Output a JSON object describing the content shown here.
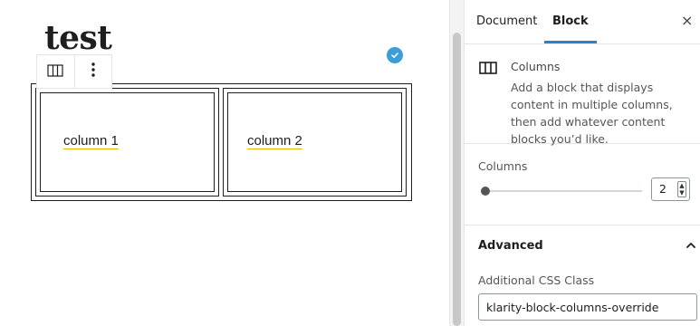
{
  "editor": {
    "post_title": "test",
    "columns": [
      {
        "text": "column 1"
      },
      {
        "text": "column 2"
      }
    ]
  },
  "sidebar": {
    "tabs": [
      {
        "label": "Document",
        "active": false
      },
      {
        "label": "Block",
        "active": true
      }
    ],
    "close_label": "×",
    "block_card": {
      "title": "Columns",
      "description": "Add a block that displays content in multiple columns, then add whatever content blocks you’d like."
    },
    "columns_panel": {
      "label": "Columns",
      "value": "2",
      "range_value": 2
    },
    "advanced_panel": {
      "title": "Advanced",
      "css_class_label": "Additional CSS Class",
      "css_class_value": "klarity-block-columns-override"
    }
  },
  "colors": {
    "accent": "#2f81c4",
    "saved_badge": "#3d9dd9",
    "underline": "#e4b700"
  },
  "icons": [
    "columns-icon",
    "more-options-icon",
    "saved-check-icon",
    "close-icon",
    "chevron-up-icon"
  ]
}
